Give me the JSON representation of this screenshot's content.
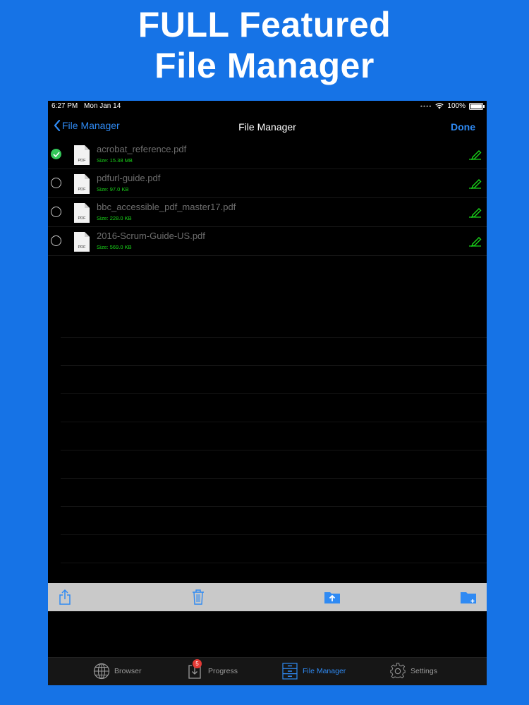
{
  "promo": {
    "line1": "FULL Featured",
    "line2": "File Manager"
  },
  "status_bar": {
    "time": "6:27 PM",
    "date": "Mon Jan 14",
    "battery": "100%"
  },
  "nav": {
    "back_label": "File Manager",
    "title": "File Manager",
    "done_label": "Done"
  },
  "files": [
    {
      "name": "acrobat_reference.pdf",
      "size": "Size: 15.38 MB",
      "selected": true,
      "icon_label": "PDF"
    },
    {
      "name": "pdfurl-guide.pdf",
      "size": "Size: 97.0 KB",
      "selected": false,
      "icon_label": "PDF"
    },
    {
      "name": "bbc_accessible_pdf_master17.pdf",
      "size": "Size: 228.0 KB",
      "selected": false,
      "icon_label": "PDF"
    },
    {
      "name": "2016-Scrum-Guide-US.pdf",
      "size": "Size: 569.0 KB",
      "selected": false,
      "icon_label": "PDF"
    }
  ],
  "toolbar": {
    "icons": [
      "share-icon",
      "trash-icon",
      "folder-upload-icon",
      "folder-add-icon"
    ]
  },
  "tabbar": {
    "tabs": [
      {
        "label": "Browser",
        "icon": "globe-icon"
      },
      {
        "label": "Progress",
        "icon": "download-icon",
        "badge": "5"
      },
      {
        "label": "File Manager",
        "icon": "file-cabinet-icon",
        "active": true
      },
      {
        "label": "Settings",
        "icon": "gear-icon"
      }
    ]
  },
  "colors": {
    "background": "#1673e6",
    "accent": "#2f8af3",
    "size_text": "#19d419",
    "check_selected": "#34c759",
    "toolbar": "#c9c9c9"
  }
}
